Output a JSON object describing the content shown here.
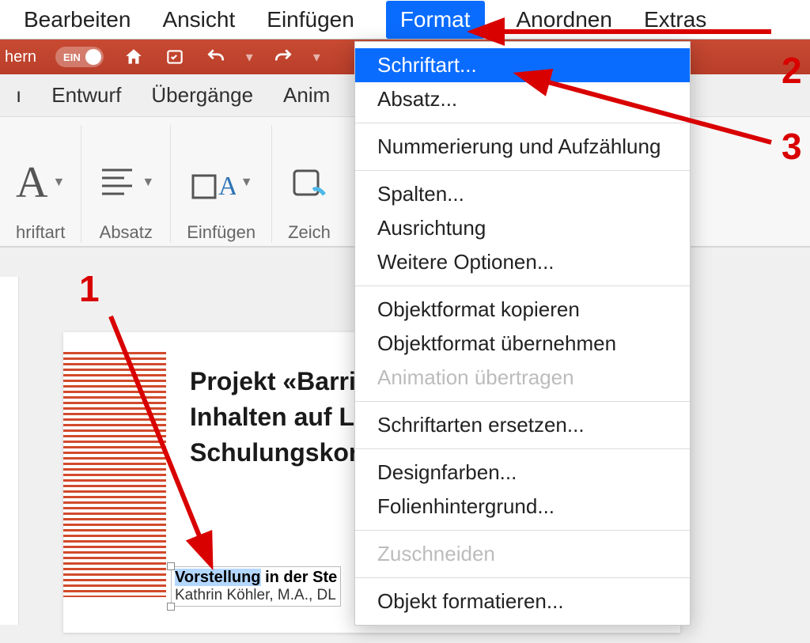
{
  "menubar": {
    "items": [
      "Bearbeiten",
      "Ansicht",
      "Einfügen",
      "Format",
      "Anordnen",
      "Extras"
    ],
    "selected_index": 3
  },
  "qat": {
    "save_fragment": "hern",
    "toggle_label": "EIN"
  },
  "tabs": {
    "items": [
      "Entwurf",
      "Übergänge",
      "Anim"
    ],
    "leading_fragment": "ı"
  },
  "ribbon_groups": {
    "font_label": "hriftart",
    "paragraph_label": "Absatz",
    "insert_label": "Einfügen",
    "draw_label": "Zeich"
  },
  "dropdown": {
    "items": [
      {
        "label": "Schriftart...",
        "state": "selected"
      },
      {
        "label": "Absatz...",
        "state": "normal"
      },
      {
        "sep": true
      },
      {
        "label": "Nummerierung und Aufzählung",
        "state": "normal"
      },
      {
        "sep": true
      },
      {
        "label": "Spalten...",
        "state": "normal"
      },
      {
        "label": "Ausrichtung",
        "state": "normal"
      },
      {
        "label": "Weitere Optionen...",
        "state": "normal"
      },
      {
        "sep": true
      },
      {
        "label": "Objektformat kopieren",
        "state": "normal"
      },
      {
        "label": "Objektformat übernehmen",
        "state": "normal"
      },
      {
        "label": "Animation übertragen",
        "state": "disabled"
      },
      {
        "sep": true
      },
      {
        "label": "Schriftarten ersetzen...",
        "state": "normal"
      },
      {
        "sep": true
      },
      {
        "label": "Designfarben...",
        "state": "normal"
      },
      {
        "label": "Folienhintergrund...",
        "state": "normal"
      },
      {
        "sep": true
      },
      {
        "label": "Zuschneiden",
        "state": "disabled"
      },
      {
        "sep": true
      },
      {
        "label": "Objekt formatieren...",
        "state": "normal"
      }
    ]
  },
  "slide": {
    "title_line1": "Projekt «Barrie",
    "title_line2": "Inhalten auf Le",
    "title_line3": "Schulungskon",
    "textbox": {
      "selected_word": "Vorstellung",
      "rest_line1": " in der Ste",
      "line2": "Kathrin Köhler, M.A., DL"
    }
  },
  "annotations": {
    "n1": "1",
    "n2": "2",
    "n3": "3"
  }
}
